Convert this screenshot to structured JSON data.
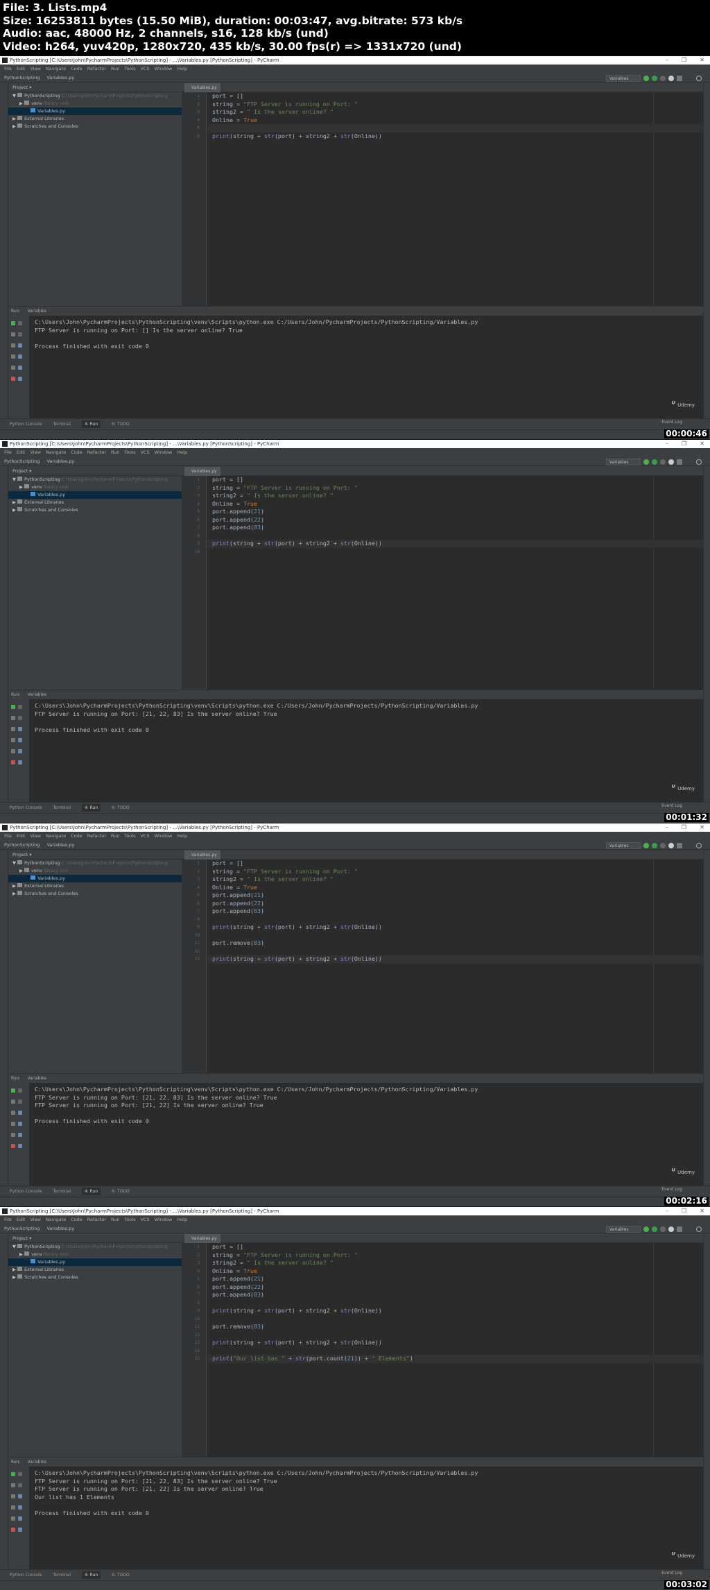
{
  "file_info": [
    "File: 3. Lists.mp4",
    "Size: 16253811 bytes (15.50 MiB), duration: 00:03:47, avg.bitrate: 573 kb/s",
    "Audio: aac, 48000 Hz, 2 channels, s16, 128 kb/s (und)",
    "Video: h264, yuv420p, 1280x720, 435 kb/s, 30.00 fps(r) => 1331x720 (und)"
  ],
  "window": {
    "title": "PythonScripting [C:\\Users\\John\\PycharmProjects\\PythonScripting] - ...\\Variables.py [PythonScripting] - PyCharm",
    "controls": [
      "–",
      "❐",
      "✕"
    ],
    "menu": [
      "File",
      "Edit",
      "View",
      "Navigate",
      "Code",
      "Refactor",
      "Run",
      "Tools",
      "VCS",
      "Window",
      "Help"
    ],
    "breadcrumb": [
      "PythonScripting",
      "Variables.py"
    ],
    "run_config": "Variables",
    "project_header": "Project ▾",
    "tree": [
      {
        "label": "PythonScripting",
        "extra": "C:\\Users\\John\\PycharmProjects\\PythonScripting",
        "indent": 0,
        "arrow": "▼"
      },
      {
        "label": "venv",
        "extra": "library root",
        "indent": 1,
        "arrow": "▶"
      },
      {
        "label": "Variables.py",
        "extra": "",
        "indent": 2,
        "arrow": "",
        "selected": true
      },
      {
        "label": "External Libraries",
        "extra": "",
        "indent": 0,
        "arrow": "▶"
      },
      {
        "label": "Scratches and Consoles",
        "extra": "",
        "indent": 0,
        "arrow": "▶"
      }
    ],
    "editor_tab": "Variables.py",
    "run_tab_label": "Run:",
    "run_tab_name": "Variables",
    "bottom_tools": [
      "Python Console",
      "Terminal",
      "4: Run",
      "6: TODO"
    ],
    "event_log": "Event Log",
    "udemy": "Udemy"
  },
  "colors": {
    "editor_bg": "#2b2b2b",
    "panel_bg": "#3c3f41",
    "string": "#6a8759",
    "number": "#6897bb",
    "keyword": "#cc7832",
    "builtin": "#8888c6"
  },
  "frames": [
    {
      "timestamp": "00:00:46",
      "cursor_line": 5,
      "code": [
        "port = []",
        "string = \"FTP Server is running on Port: \"",
        "string2 = \" Is the server online? \"",
        "Online = True",
        "",
        "print(string + str(port) + string2 + str(Online))"
      ],
      "console": [
        "C:\\Users\\John\\PycharmProjects\\PythonScripting\\venv\\Scripts\\python.exe C:/Users/John/PycharmProjects/PythonScripting/Variables.py",
        "FTP Server is running on Port: [] Is the server online? True",
        "",
        "Process finished with exit code 0"
      ]
    },
    {
      "timestamp": "00:01:32",
      "cursor_line": 9,
      "code": [
        "port = []",
        "string = \"FTP Server is running on Port: \"",
        "string2 = \" Is the server online? \"",
        "Online = True",
        "port.append(21)",
        "port.append(22)",
        "port.append(83)",
        "",
        "print(string + str(port) + string2 + str(Online))",
        ""
      ],
      "console": [
        "C:\\Users\\John\\PycharmProjects\\PythonScripting\\venv\\Scripts\\python.exe C:/Users/John/PycharmProjects/PythonScripting/Variables.py",
        "FTP Server is running on Port: [21, 22, 83] Is the server online? True",
        "",
        "Process finished with exit code 0"
      ]
    },
    {
      "timestamp": "00:02:16",
      "cursor_line": 13,
      "code": [
        "port = []",
        "string = \"FTP Server is running on Port: \"",
        "string2 = \" Is the server online? \"",
        "Online = True",
        "port.append(21)",
        "port.append(22)",
        "port.append(83)",
        "",
        "print(string + str(port) + string2 + str(Online))",
        "",
        "port.remove(83)",
        "",
        "print(string + str(port) + string2 + str(Online))"
      ],
      "console": [
        "C:\\Users\\John\\PycharmProjects\\PythonScripting\\venv\\Scripts\\python.exe C:/Users/John/PycharmProjects/PythonScripting/Variables.py",
        "FTP Server is running on Port: [21, 22, 83] Is the server online? True",
        "FTP Server is running on Port: [21, 22] Is the server online? True",
        "",
        "Process finished with exit code 0"
      ]
    },
    {
      "timestamp": "00:03:02",
      "cursor_line": 15,
      "code": [
        "port = []",
        "string = \"FTP Server is running on Port: \"",
        "string2 = \" Is the server online? \"",
        "Online = True",
        "port.append(21)",
        "port.append(22)",
        "port.append(83)",
        "",
        "print(string + str(port) + string2 + str(Online))",
        "",
        "port.remove(83)",
        "",
        "print(string + str(port) + string2 + str(Online))",
        "",
        "print(\"Our list has \" + str(port.count(21)) + \" Elements\")"
      ],
      "console": [
        "C:\\Users\\John\\PycharmProjects\\PythonScripting\\venv\\Scripts\\python.exe C:/Users/John/PycharmProjects/PythonScripting/Variables.py",
        "FTP Server is running on Port: [21, 22, 83] Is the server online? True",
        "FTP Server is running on Port: [21, 22] Is the server online? True",
        "Our list has 1 Elements",
        "",
        "Process finished with exit code 0"
      ]
    }
  ]
}
